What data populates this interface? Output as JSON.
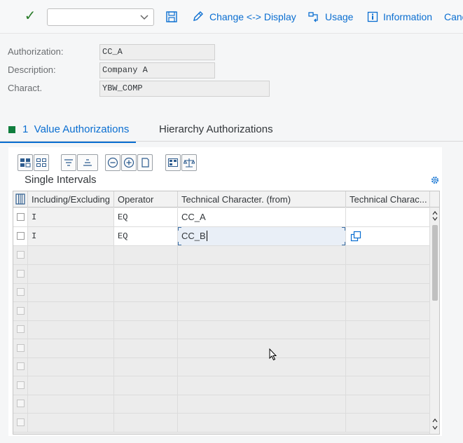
{
  "toolbar": {
    "select_value": "",
    "change_display_label": "Change <-> Display",
    "usage_label": "Usage",
    "information_label": "Information",
    "cancel_label": "Canc"
  },
  "header": {
    "authorization_label": "Authorization:",
    "authorization_value": "CC_A",
    "description_label": "Description:",
    "description_value": "Company A",
    "charact_label": "Charact.",
    "charact_value": "YBW_COMP"
  },
  "tabs": [
    {
      "label": "1  Value Authorizations",
      "active": true
    },
    {
      "label": "Hierarchy Authorizations",
      "active": false
    }
  ],
  "section_title": "Single Intervals",
  "table": {
    "columns": [
      "Including/Excluding",
      "Operator",
      "Technical Character. (from)",
      "Technical Charac..."
    ],
    "rows": [
      {
        "incl": "I",
        "operator": "EQ",
        "from": "CC_A",
        "to": ""
      },
      {
        "incl": "I",
        "operator": "EQ",
        "from": "CC_B",
        "to": ""
      }
    ],
    "empty_rows": 10
  },
  "colors": {
    "accent": "#0a6ed1",
    "ok_green": "#2b7d2b",
    "tab_marker": "#107e3e"
  }
}
